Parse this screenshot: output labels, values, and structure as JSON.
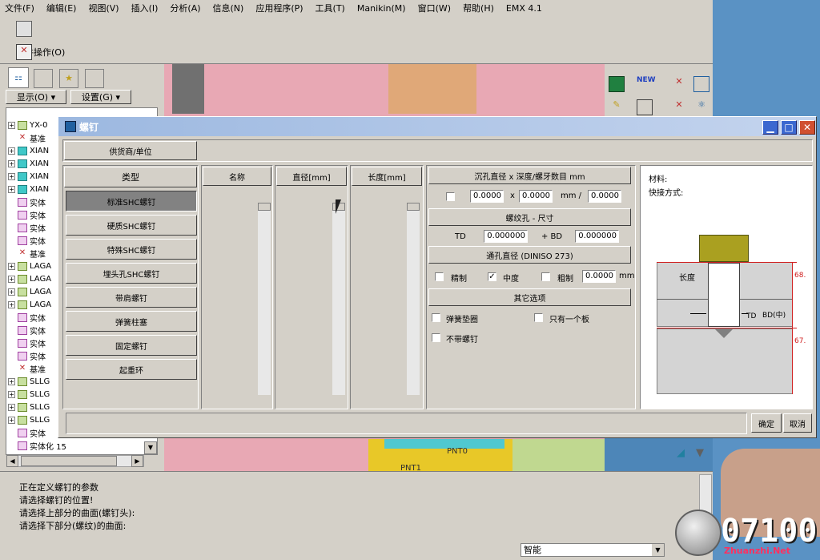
{
  "menubar": {
    "items": [
      "文件(F)",
      "编辑(E)",
      "视图(V)",
      "插入(I)",
      "分析(A)",
      "信息(N)",
      "应用程序(P)",
      "工具(T)",
      "Manikin(M)",
      "窗口(W)",
      "帮助(H)",
      "EMX 4.1"
    ]
  },
  "toolbar": {
    "component_ops_label": "元件操作(O)"
  },
  "left_panel": {
    "display_label": "显示(O)",
    "settings_label": "设置(G)",
    "tree": [
      {
        "text": "YX-0",
        "type": "part",
        "expandable": true
      },
      {
        "text": "基准",
        "type": "x",
        "expandable": false
      },
      {
        "text": "XIAN",
        "type": "cube",
        "expandable": true
      },
      {
        "text": "XIAN",
        "type": "cube",
        "expandable": true
      },
      {
        "text": "XIAN",
        "type": "cube",
        "expandable": true
      },
      {
        "text": "XIAN",
        "type": "cube",
        "expandable": true
      },
      {
        "text": "实体",
        "type": "feat",
        "expandable": false
      },
      {
        "text": "实体",
        "type": "feat",
        "expandable": false
      },
      {
        "text": "实体",
        "type": "feat",
        "expandable": false
      },
      {
        "text": "实体",
        "type": "feat",
        "expandable": false
      },
      {
        "text": "基准",
        "type": "x",
        "expandable": false
      },
      {
        "text": "LAGA",
        "type": "part",
        "expandable": true
      },
      {
        "text": "LAGA",
        "type": "part",
        "expandable": true
      },
      {
        "text": "LAGA",
        "type": "part",
        "expandable": true
      },
      {
        "text": "LAGA",
        "type": "part",
        "expandable": true
      },
      {
        "text": "实体",
        "type": "feat",
        "expandable": false
      },
      {
        "text": "实体",
        "type": "feat",
        "expandable": false
      },
      {
        "text": "实体",
        "type": "feat",
        "expandable": false
      },
      {
        "text": "实体",
        "type": "feat",
        "expandable": false
      },
      {
        "text": "基准",
        "type": "x",
        "expandable": false
      },
      {
        "text": "SLLG",
        "type": "part",
        "expandable": true
      },
      {
        "text": "SLLG",
        "type": "part",
        "expandable": true
      },
      {
        "text": "SLLG",
        "type": "part",
        "expandable": true
      },
      {
        "text": "SLLG",
        "type": "part",
        "expandable": true
      },
      {
        "text": "实体",
        "type": "feat",
        "expandable": false
      },
      {
        "text": "实体化 15",
        "type": "feat",
        "expandable": false
      }
    ]
  },
  "messages": [
    "正在定义螺钉的参数",
    "请选择螺钉的位置!",
    "请选择上部分的曲面(螺钉头):",
    "请选择下部分(螺纹)的曲面:"
  ],
  "status": {
    "filter_value": "智能"
  },
  "watermark": {
    "number": "07100",
    "site": "Zhuanzhi.Net"
  },
  "viewport_labels": {
    "pnt_a": "PNT0",
    "pnt_b": "PNT1"
  },
  "dialog": {
    "title": "螺钉",
    "supplier_unit": "供货商/单位",
    "type_header": "类型",
    "types": [
      "标准SHC螺钉",
      "硬质SHC螺钉",
      "特殊SHC螺钉",
      "埋头孔SHC螺钉",
      "带肩螺钉",
      "弹簧柱塞",
      "固定螺钉",
      "起重环"
    ],
    "selected_type_index": 0,
    "name_header": "名称",
    "diameter_header": "直径[mm]",
    "length_header": "长度[mm]",
    "counterbore_header": "沉孔直径 x 深度/螺牙数目 mm",
    "cb_diameter": "0.0000",
    "cb_x": "x",
    "cb_depth": "0.0000",
    "cb_unit_sep": "mm /",
    "cb_threads": "0.0000",
    "thread_hole_header": "螺纹孔 - 尺寸",
    "td_label": "TD",
    "td_value": "0.000000",
    "bd_label": "+ BD",
    "bd_value": "0.000000",
    "through_hole_header": "通孔直径 (DINISO 273)",
    "fine_label": "精制",
    "medium_label": "中度",
    "coarse_label": "粗制",
    "through_value": "0.0000",
    "through_unit": "mm",
    "other_options": "其它选项",
    "spring_washer": "弹簧垫圈",
    "one_plate_only": "只有一个板",
    "no_screw": "不带螺钉",
    "material_label": "材料:",
    "quick_method_label": "快接方式:",
    "diagram": {
      "length_label": "长度",
      "td_label": "TD",
      "bd_label": "BD(中)",
      "dim_top": "68.",
      "dim_bottom": "67."
    },
    "ok": "确定",
    "cancel": "取消"
  }
}
